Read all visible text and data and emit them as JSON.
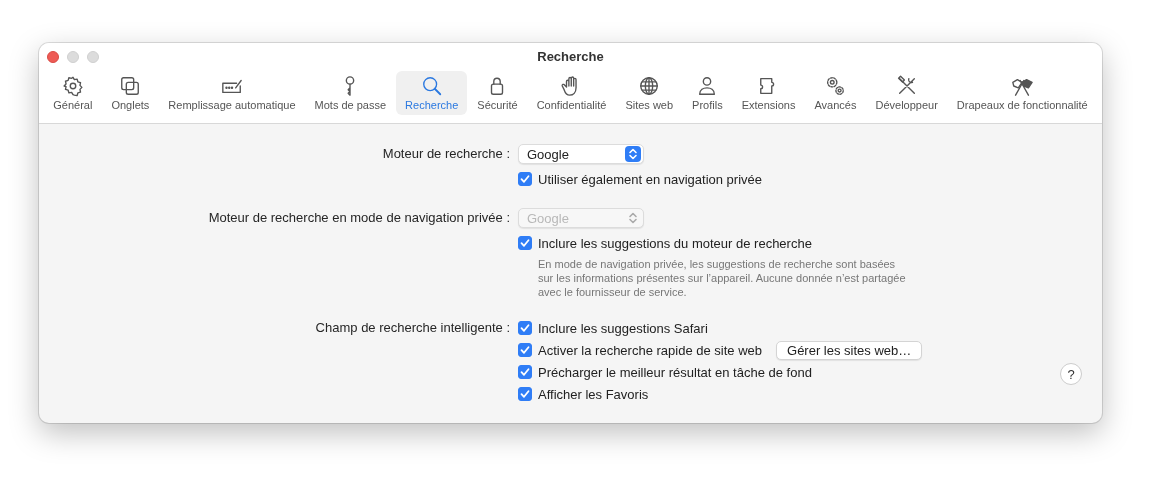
{
  "window": {
    "title": "Recherche"
  },
  "toolbar": [
    {
      "label": "Général",
      "selected": false
    },
    {
      "label": "Onglets",
      "selected": false
    },
    {
      "label": "Remplissage automatique",
      "selected": false
    },
    {
      "label": "Mots de passe",
      "selected": false
    },
    {
      "label": "Recherche",
      "selected": true
    },
    {
      "label": "Sécurité",
      "selected": false
    },
    {
      "label": "Confidentialité",
      "selected": false
    },
    {
      "label": "Sites web",
      "selected": false
    },
    {
      "label": "Profils",
      "selected": false
    },
    {
      "label": "Extensions",
      "selected": false
    },
    {
      "label": "Avancés",
      "selected": false
    },
    {
      "label": "Développeur",
      "selected": false
    },
    {
      "label": "Drapeaux de fonctionnalité",
      "selected": false
    }
  ],
  "sections": [
    {
      "label": "Moteur de recherche :",
      "popup": {
        "value": "Google",
        "disabled": false
      },
      "options": [
        {
          "label": "Utiliser également en navigation privée",
          "checked": true
        }
      ]
    },
    {
      "label": "Moteur de recherche en mode de navigation privée :",
      "popup": {
        "value": "Google",
        "disabled": true
      },
      "options": [
        {
          "label": "Inclure les suggestions du moteur de recherche",
          "checked": true
        }
      ],
      "note": "En mode de navigation privée, les suggestions de recherche sont basées sur les informations présentes sur l’appareil. Aucune donnée n’est partagée avec le fournisseur de service."
    },
    {
      "label": "Champ de recherche intelligente :",
      "options": [
        {
          "label": "Inclure les suggestions Safari",
          "checked": true
        },
        {
          "label": "Activer la recherche rapide de site web",
          "checked": true,
          "button": "Gérer les sites web…"
        },
        {
          "label": "Précharger le meilleur résultat en tâche de fond",
          "checked": true
        },
        {
          "label": "Afficher les Favoris",
          "checked": true
        }
      ]
    }
  ],
  "help": "?"
}
